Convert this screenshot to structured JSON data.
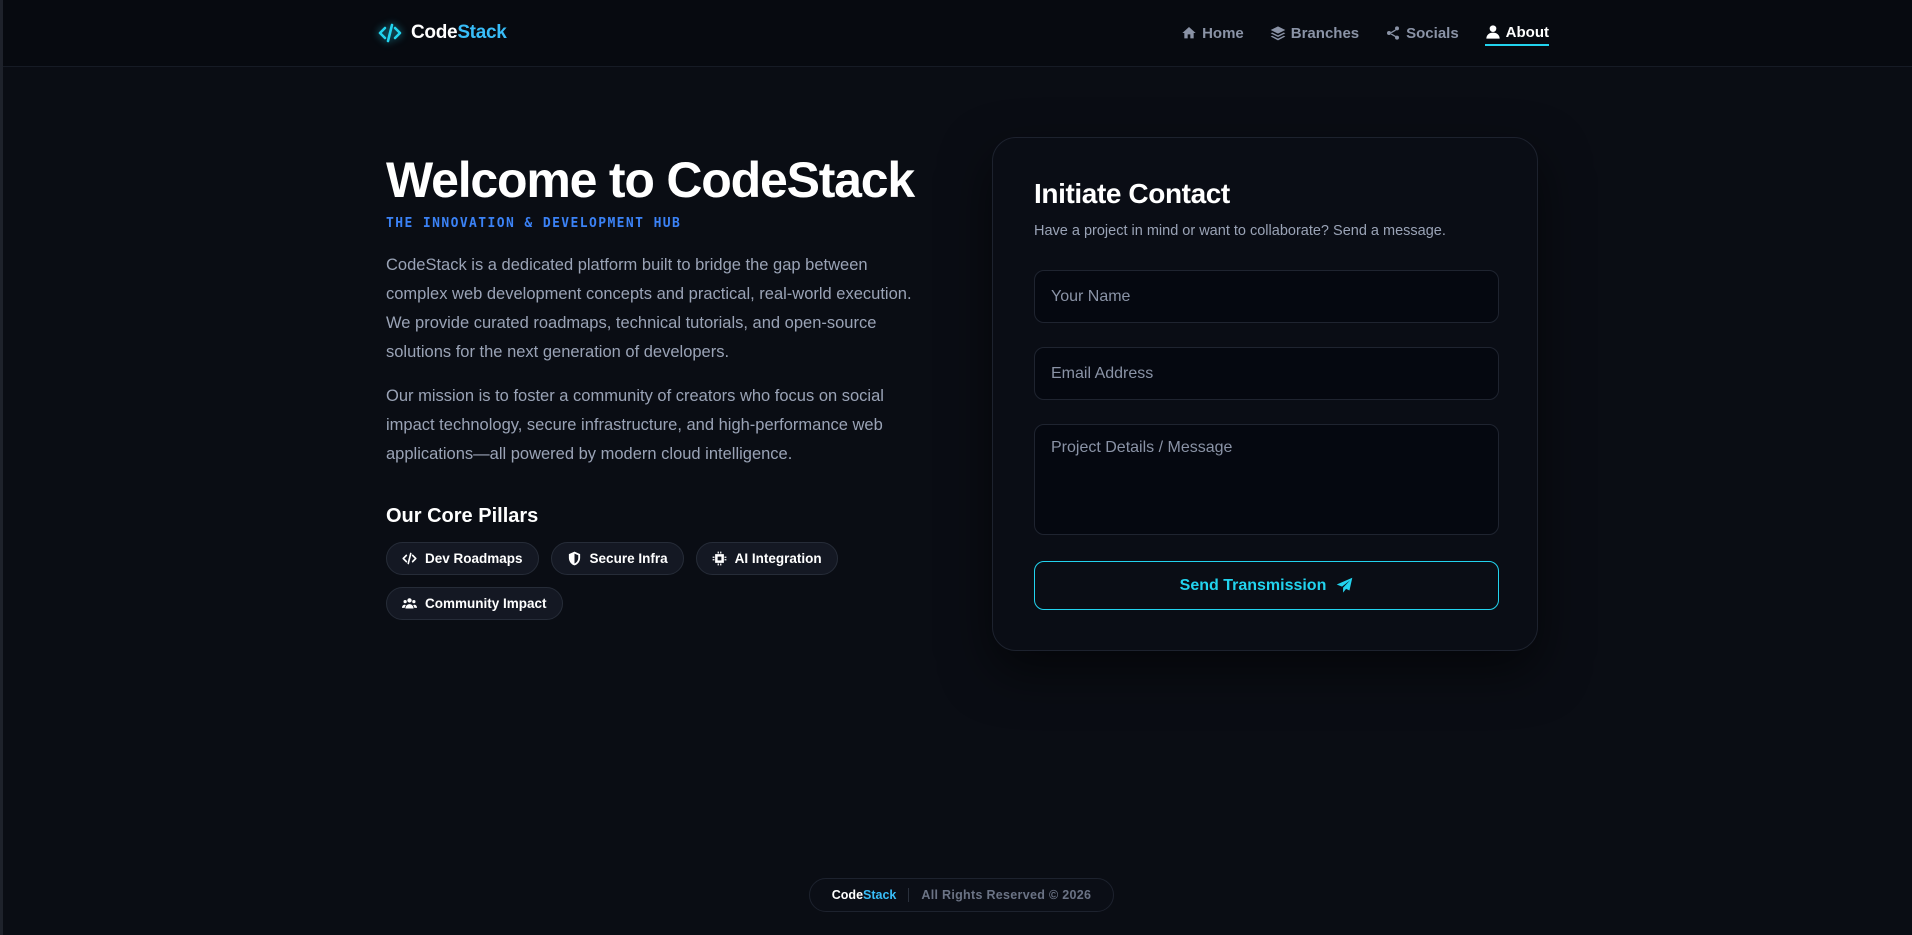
{
  "brand": {
    "part1": "Code",
    "part2": "Stack"
  },
  "nav": {
    "items": [
      {
        "label": "Home",
        "icon": "home-icon"
      },
      {
        "label": "Branches",
        "icon": "layers-icon"
      },
      {
        "label": "Socials",
        "icon": "share-icon"
      },
      {
        "label": "About",
        "icon": "user-icon",
        "active": true
      }
    ]
  },
  "hero": {
    "title": "Welcome to CodeStack",
    "tagline": "THE INNOVATION & DEVELOPMENT HUB",
    "paragraph1": "CodeStack is a dedicated platform built to bridge the gap between complex web development concepts and practical, real-world execution. We provide curated roadmaps, technical tutorials, and open-source solutions for the next generation of developers.",
    "paragraph2": "Our mission is to foster a community of creators who focus on social impact technology, secure infrastructure, and high-performance web applications—all powered by modern cloud intelligence.",
    "pillars_heading": "Our Core Pillars",
    "pillars": [
      {
        "label": "Dev Roadmaps",
        "icon": "code-icon"
      },
      {
        "label": "Secure Infra",
        "icon": "shield-icon"
      },
      {
        "label": "AI Integration",
        "icon": "chip-icon"
      },
      {
        "label": "Community Impact",
        "icon": "users-icon"
      }
    ]
  },
  "contact": {
    "title": "Initiate Contact",
    "subtitle": "Have a project in mind or want to collaborate? Send a message.",
    "name_placeholder": "Your Name",
    "email_placeholder": "Email Address",
    "message_placeholder": "Project Details / Message",
    "send_label": "Send Transmission"
  },
  "footer": {
    "brand1": "Code",
    "brand2": "Stack",
    "copyright": "All Rights Reserved © 2026"
  },
  "colors": {
    "accent": "#22d3ee",
    "brand_blue": "#38bdf8",
    "tagline_blue": "#3b82f6",
    "background": "#0a0d14"
  }
}
